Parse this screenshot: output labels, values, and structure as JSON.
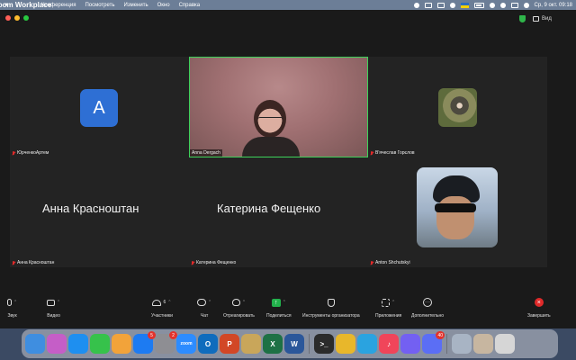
{
  "menubar": {
    "app_name": "Zoom Workplace",
    "items": [
      "Конференция",
      "Посмотреть",
      "Изменить",
      "Окно",
      "Справка"
    ],
    "clock": "Ср, 9 окт.  09:18"
  },
  "titlebar": {
    "view_label": "Вид"
  },
  "participants": {
    "tile1": {
      "avatar_letter": "A",
      "name": "ЮрченкоАртем"
    },
    "tile2": {
      "name": "Anna Dergach"
    },
    "tile3": {
      "name": "В'ячеслав Горєлов"
    },
    "tile4": {
      "big_name": "Анна Красноштан",
      "name": "Анна Красноштан"
    },
    "tile5": {
      "big_name": "Катерина Фещенко",
      "name": "Катерина Фещенко"
    },
    "tile6": {
      "name": "Anton Shchutskyi"
    }
  },
  "toolbar": {
    "audio": "Звук",
    "video": "Видео",
    "participants": "Участники",
    "participants_count": "6",
    "chat": "Чат",
    "react": "Отреагировать",
    "share": "Поделиться",
    "host_tools": "Инструменты организатора",
    "apps": "Приложения",
    "more": "Дополнительно",
    "end": "Завершить"
  },
  "dock": {
    "apps": [
      {
        "icon": "finder-icon",
        "color": "#3f8ee0",
        "glyph": ""
      },
      {
        "icon": "launchpad-icon",
        "color": "#c55ec7",
        "glyph": ""
      },
      {
        "icon": "safari-icon",
        "color": "#1e8ff0",
        "glyph": ""
      },
      {
        "icon": "facetime-icon",
        "color": "#36c24b",
        "glyph": ""
      },
      {
        "icon": "photos-icon",
        "color": "#f2a33a",
        "glyph": ""
      },
      {
        "icon": "app-store-icon",
        "color": "#1d7bf2",
        "glyph": "",
        "badge": "5"
      },
      {
        "icon": "system-settings-icon",
        "color": "#8e8e93",
        "glyph": "",
        "badge": "2"
      },
      {
        "icon": "zoom-icon",
        "color": "#2d8cff",
        "glyph": "zoom"
      },
      {
        "icon": "outlook-icon",
        "color": "#0f6cbd",
        "glyph": "O"
      },
      {
        "icon": "powerpoint-icon",
        "color": "#d24726",
        "glyph": "P"
      },
      {
        "icon": "notes-icon",
        "color": "#c9a65a",
        "glyph": ""
      },
      {
        "icon": "excel-icon",
        "color": "#1e7145",
        "glyph": "X"
      },
      {
        "icon": "word-icon",
        "color": "#2b579a",
        "glyph": "W"
      },
      {
        "icon": "terminal-icon",
        "color": "#2b2b2b",
        "glyph": ">_"
      },
      {
        "icon": "chrome-icon",
        "color": "#e8b72b",
        "glyph": ""
      },
      {
        "icon": "telegram-icon",
        "color": "#2aa3e0",
        "glyph": ""
      },
      {
        "icon": "music-icon",
        "color": "#f0455a",
        "glyph": "♪"
      },
      {
        "icon": "viber-icon",
        "color": "#7360f2",
        "glyph": ""
      },
      {
        "icon": "messenger-icon",
        "color": "#5b6ef5",
        "glyph": "",
        "badge": "40"
      },
      {
        "icon": "downloads-folder-icon",
        "color": "#a8b4c4",
        "glyph": ""
      },
      {
        "icon": "documents-folder-icon",
        "color": "#c7b6a0",
        "glyph": ""
      },
      {
        "icon": "trash-icon",
        "color": "#d6d6d6",
        "glyph": ""
      }
    ]
  },
  "colors": {
    "active_speaker_border": "#3ed15a",
    "end_button": "#e02a2a",
    "share_button": "#22b14c",
    "avatar_blue": "#2e6fd4"
  }
}
